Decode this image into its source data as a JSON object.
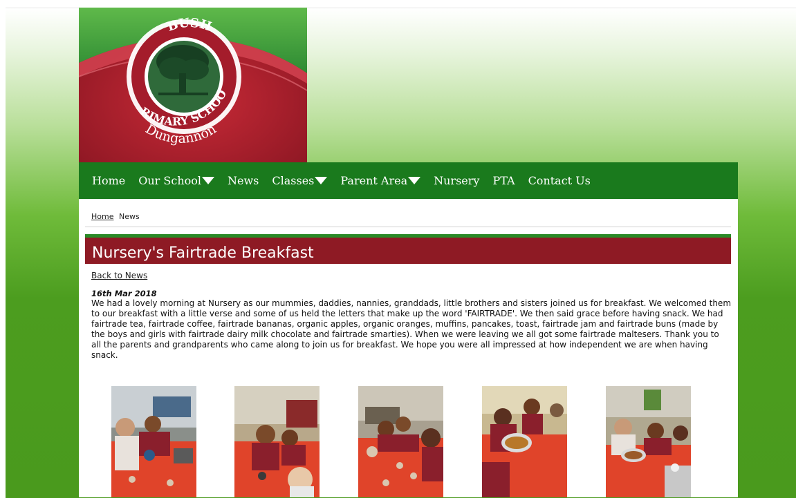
{
  "logo": {
    "text_top": "BUSH",
    "text_ring": "PRIMARY SCHOOL",
    "text_bottom": "Dungannon"
  },
  "nav": {
    "items": [
      {
        "label": "Home",
        "dropdown": false
      },
      {
        "label": "Our School",
        "dropdown": true
      },
      {
        "label": "News",
        "dropdown": false
      },
      {
        "label": "Classes",
        "dropdown": true
      },
      {
        "label": "Parent Area",
        "dropdown": true
      },
      {
        "label": "Nursery",
        "dropdown": false
      },
      {
        "label": "PTA",
        "dropdown": false
      },
      {
        "label": "Contact Us",
        "dropdown": false
      }
    ]
  },
  "breadcrumb": {
    "home": "Home",
    "current": "News"
  },
  "article": {
    "title": "Nursery's Fairtrade Breakfast",
    "back_link": "Back to News",
    "date": "16th Mar 2018",
    "body": "We had a lovely morning at Nursery as our mummies, daddies, nannies, granddads, little brothers and sisters joined us for breakfast. We welcomed them to our breakfast with a little verse and some of us held the letters that make up the word 'FAIRTRADE'. We then said grace before having snack. We had fairtrade tea, fairtrade coffee, fairtrade bananas, organic apples, organic oranges, muffins, pancakes, toast, fairtrade jam and fairtrade buns (made by the boys and girls with fairtrade dairy milk chocolate and fairtrade smarties). When we were leaving we all got some fairtrade maltesers. Thank you to all the parents and grandparents who came along to join us for breakfast. We hope you were all impressed at how independent we are when having snack."
  },
  "colors": {
    "nav_green": "#1a7a1d",
    "title_maroon": "#8e1a24",
    "logo_red": "#b21f2e"
  }
}
